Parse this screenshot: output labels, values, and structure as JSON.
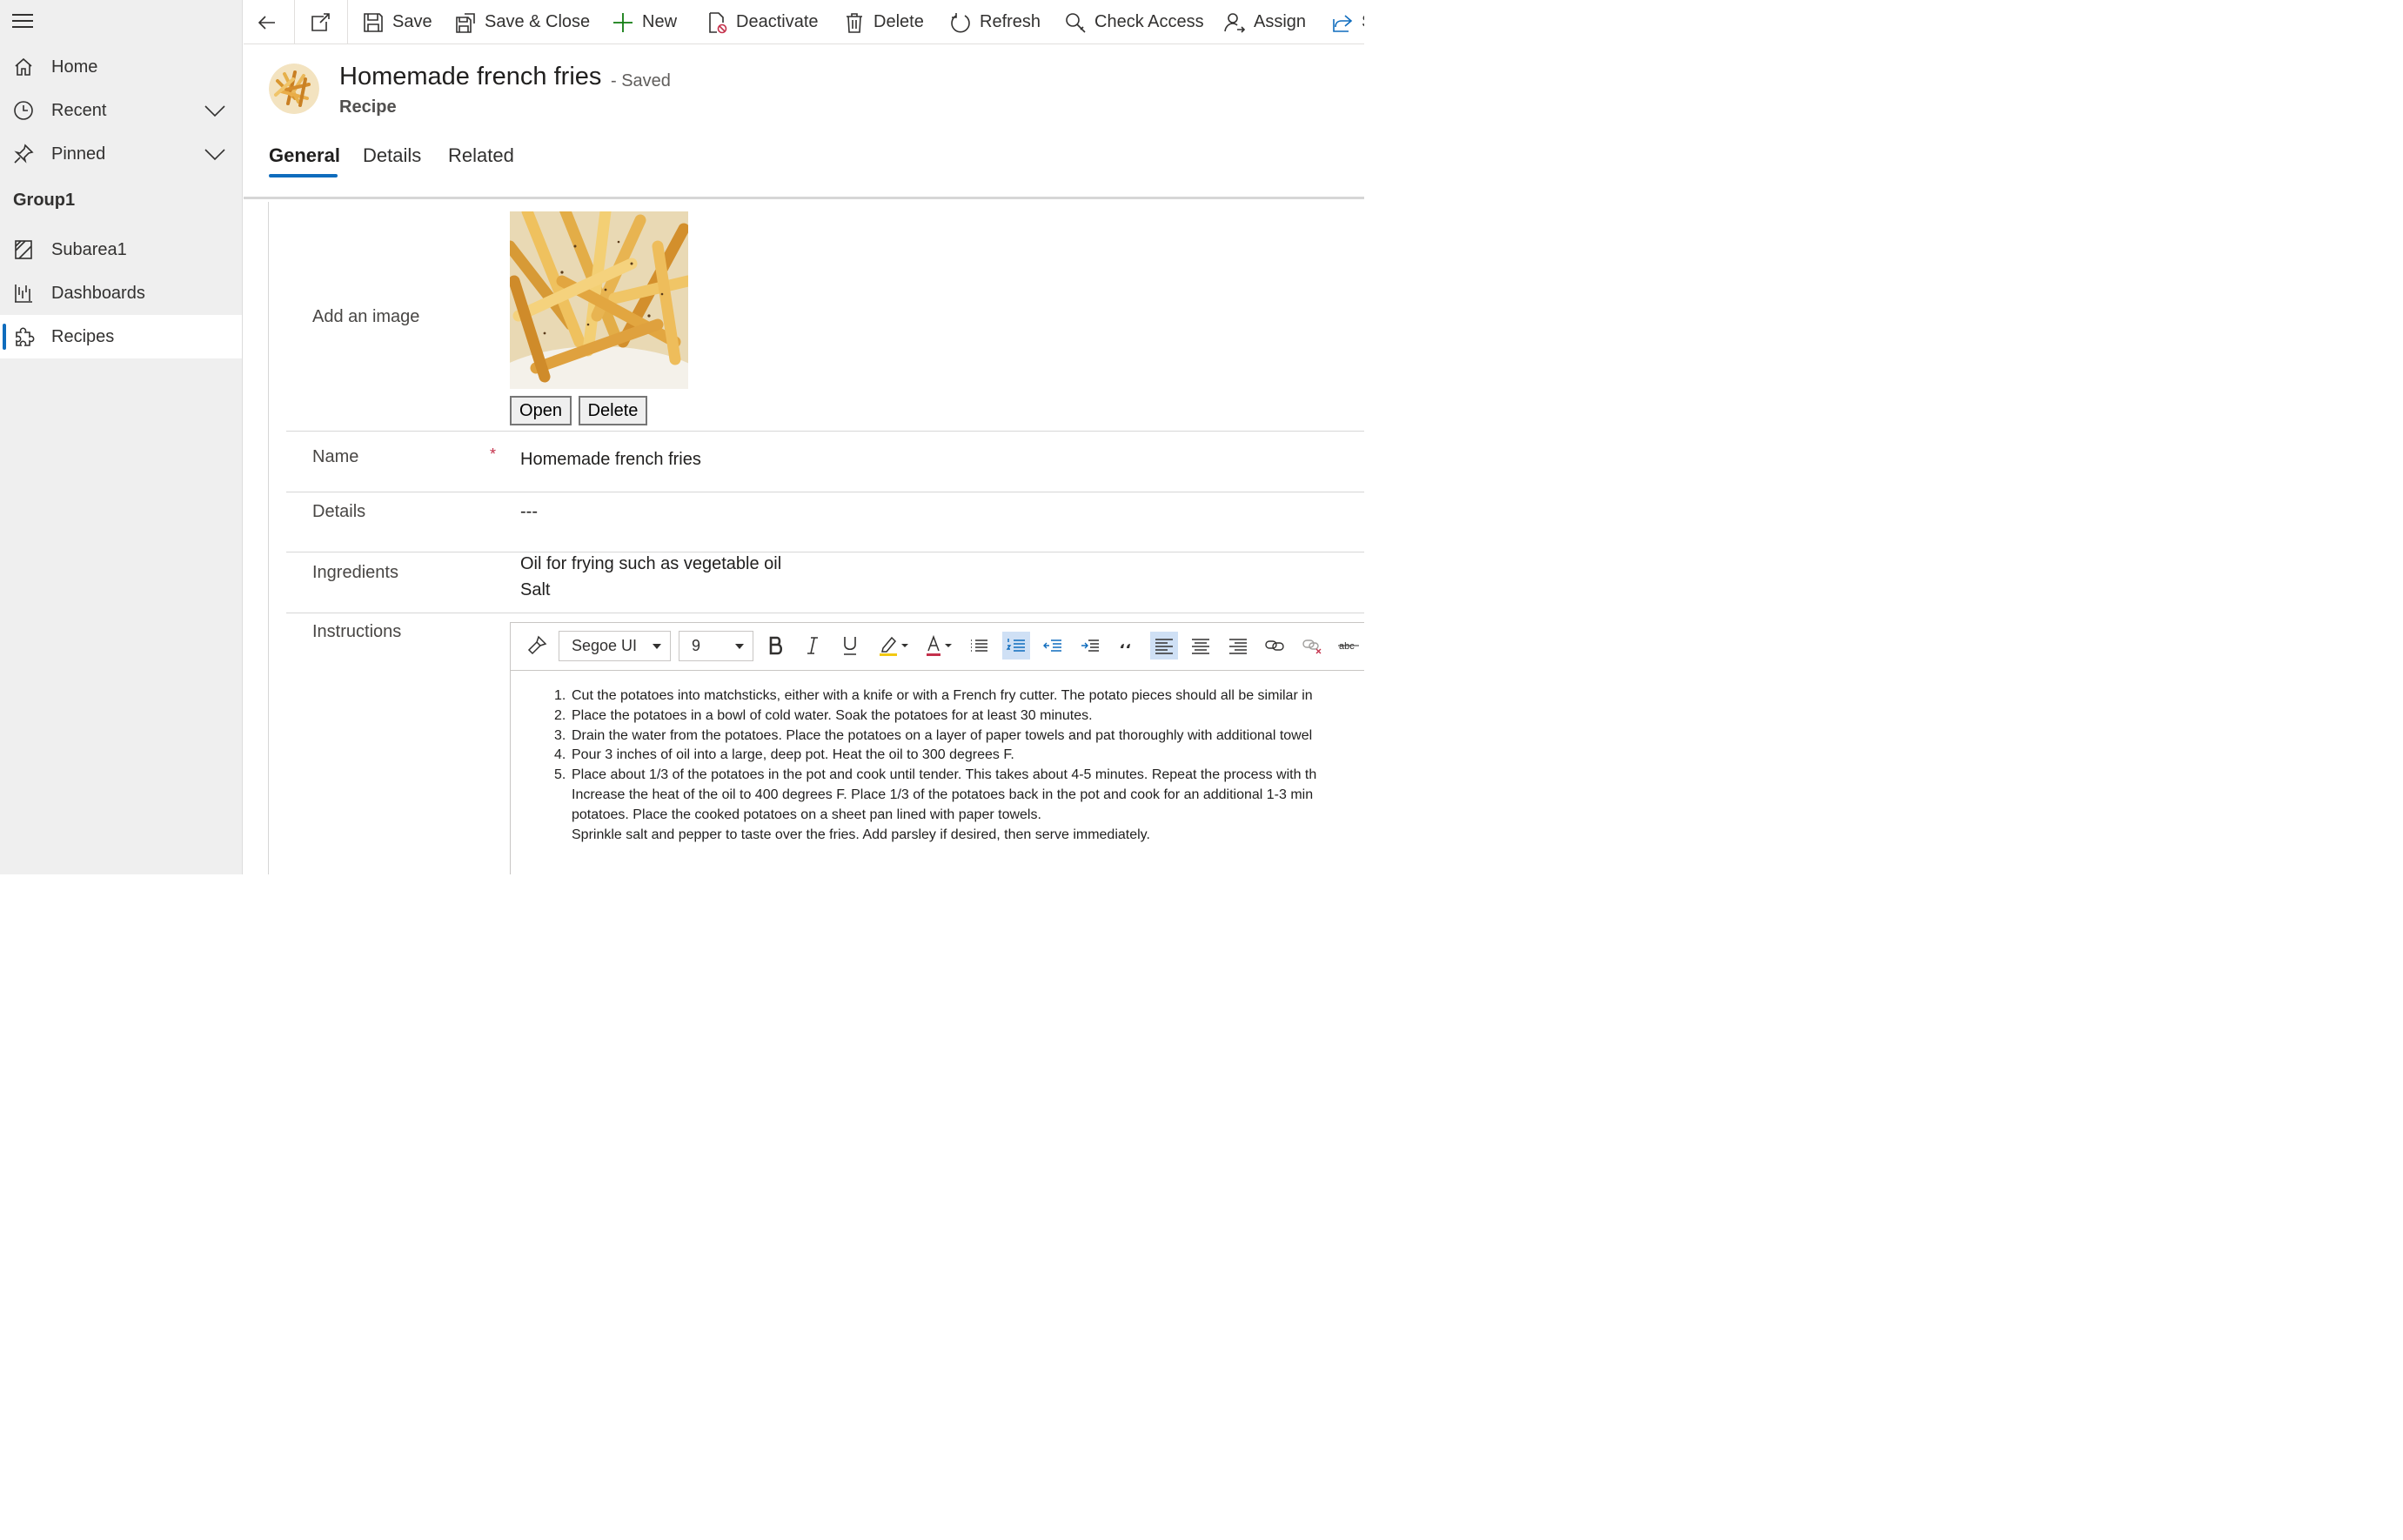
{
  "sidebar": {
    "items": [
      {
        "label": "Home"
      },
      {
        "label": "Recent"
      },
      {
        "label": "Pinned"
      }
    ],
    "group": "Group1",
    "area_items": [
      {
        "label": "Subarea1"
      },
      {
        "label": "Dashboards"
      },
      {
        "label": "Recipes"
      }
    ]
  },
  "toolbar": {
    "save": "Save",
    "save_close": "Save & Close",
    "new": "New",
    "deactivate": "Deactivate",
    "delete": "Delete",
    "refresh": "Refresh",
    "check_access": "Check Access",
    "assign": "Assign",
    "share_partial": "S"
  },
  "header": {
    "title": "Homemade french fries",
    "status": "- Saved",
    "entity": "Recipe"
  },
  "tabs": [
    {
      "label": "General"
    },
    {
      "label": "Details"
    },
    {
      "label": "Related"
    }
  ],
  "form": {
    "image_label": "Add an image",
    "open_button": "Open",
    "delete_button": "Delete",
    "name_label": "Name",
    "required_marker": "*",
    "name_value": "Homemade french fries",
    "details_label": "Details",
    "details_value": "---",
    "ingredients_label": "Ingredients",
    "ingredients_lines": [
      "Oil for frying such as vegetable oil",
      "Salt"
    ],
    "instructions_label": "Instructions"
  },
  "editor": {
    "font": "Segoe UI",
    "size": "9",
    "steps": [
      {
        "num": "1.",
        "text": "Cut the potatoes into matchsticks, either with a knife or with a French fry cutter. The potato pieces should all be similar in"
      },
      {
        "num": "2.",
        "text": "Place the potatoes in a bowl of cold water. Soak the potatoes for at least 30 minutes."
      },
      {
        "num": "3.",
        "text": "Drain the water from the potatoes. Place the potatoes on a layer of paper towels and pat thoroughly with additional towel"
      },
      {
        "num": "4.",
        "text": "Pour 3 inches of oil into a large, deep pot. Heat the oil to 300 degrees F."
      },
      {
        "num": "5.",
        "text": "Place about 1/3 of the potatoes in the pot and cook until tender. This takes about 4-5 minutes. Repeat the process with th"
      },
      {
        "num": "",
        "text": "Increase the heat of the oil to 400 degrees F. Place 1/3 of the potatoes back in the pot and cook for an additional 1-3 min"
      },
      {
        "num": "",
        "text": "potatoes. Place the cooked potatoes on a sheet pan lined with paper towels."
      },
      {
        "num": "",
        "text": "Sprinkle salt and pepper to taste over the fries. Add parsley if desired, then serve immediately."
      }
    ]
  },
  "colors": {
    "accent": "#0f6cbd",
    "required": "#c4314b",
    "sidebar_bg": "#efefef"
  }
}
